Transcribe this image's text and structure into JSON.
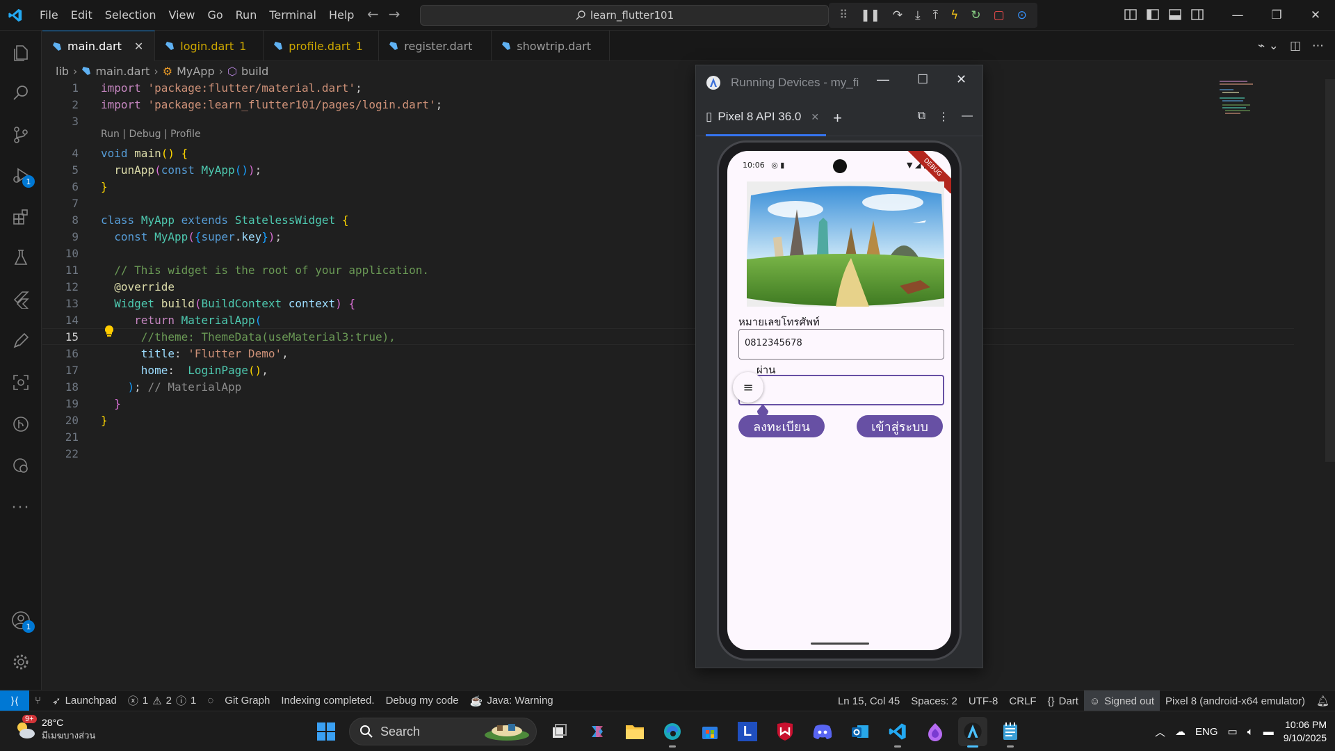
{
  "titlebar": {
    "menu": [
      "File",
      "Edit",
      "Selection",
      "View",
      "Go",
      "Run",
      "Terminal",
      "Help"
    ],
    "search": "learn_flutter101"
  },
  "tabs": [
    {
      "label": "main.dart",
      "active": true,
      "modified_count": ""
    },
    {
      "label": "login.dart",
      "active": false,
      "modified_count": "1"
    },
    {
      "label": "profile.dart",
      "active": false,
      "modified_count": "1"
    },
    {
      "label": "register.dart",
      "active": false,
      "modified_count": ""
    },
    {
      "label": "showtrip.dart",
      "active": false,
      "modified_count": ""
    }
  ],
  "breadcrumb": {
    "folder": "lib",
    "file": "main.dart",
    "class": "MyApp",
    "method": "build"
  },
  "editor": {
    "codelens": "Run | Debug | Profile",
    "current_line": 15,
    "line_numbers": [
      "1",
      "2",
      "3",
      "4",
      "5",
      "6",
      "7",
      "8",
      "9",
      "10",
      "11",
      "12",
      "13",
      "14",
      "15",
      "16",
      "17",
      "18",
      "19",
      "20",
      "21",
      "22"
    ]
  },
  "activity_badges": {
    "run_debug": "1",
    "accounts": "1"
  },
  "running_devices": {
    "title": "Running Devices - my_fi",
    "device_tab": "Pixel 8 API 36.0",
    "phone": {
      "time": "10:06",
      "ribbon": "DEBUG",
      "phone_label": "หมายเลขโทรศัพท์",
      "phone_value": "0812345678",
      "password_label": "รหัสผ่าน",
      "password_label_visible": "ผ่าน",
      "register_button": "ลงทะเบียน",
      "login_button": "เข้าสู่ระบบ"
    }
  },
  "statusbar": {
    "launchpad": "Launchpad",
    "errors": "1",
    "warnings": "2",
    "infos": "1",
    "git_graph": "Git Graph",
    "indexing": "Indexing completed.",
    "debug_my_code": "Debug my code",
    "java": "Java: Warning",
    "position": "Ln 15, Col 45",
    "spaces": "Spaces: 2",
    "encoding": "UTF-8",
    "eol": "CRLF",
    "language": "Dart",
    "signed_out": "Signed out",
    "device": "Pixel 8 (android-x64 emulator)"
  },
  "taskbar": {
    "weather_temp": "28°C",
    "weather_desc": "มีเมฆบางส่วน",
    "weather_badge": "9+",
    "search_placeholder": "Search",
    "lang": "ENG",
    "time": "10:06 PM",
    "date": "9/10/2025"
  },
  "colors": {
    "accent": "#0078d4",
    "flutter_primary": "#6750a4",
    "editor_bg": "#1f1f1f"
  }
}
